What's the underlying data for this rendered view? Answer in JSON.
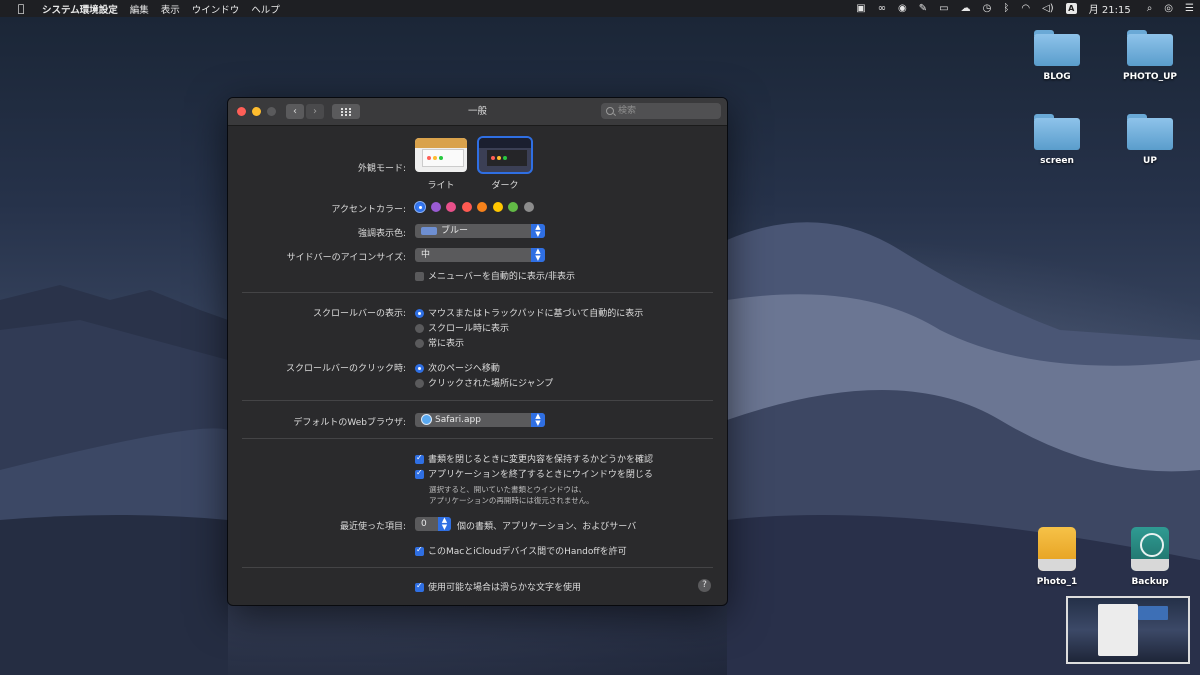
{
  "menubar": {
    "app_name": "システム環境設定",
    "items": [
      "編集",
      "表示",
      "ウインドウ",
      "ヘルプ"
    ],
    "clock": "月 21:15",
    "input_badge": "A",
    "status_icons": [
      "screen-mirroring-icon",
      "creative-cloud-icon",
      "toggl-icon",
      "pin-icon",
      "battery-icon",
      "cloud-icon",
      "time-machine-icon",
      "bluetooth-icon",
      "wifi-icon",
      "volume-icon",
      "input-source-icon",
      "spotlight-icon",
      "siri-icon",
      "notification-center-icon"
    ]
  },
  "desktop": {
    "icons": [
      {
        "label": "BLOG",
        "kind": "folder"
      },
      {
        "label": "PHOTO_UP",
        "kind": "folder"
      },
      {
        "label": "screen",
        "kind": "folder"
      },
      {
        "label": "UP",
        "kind": "folder"
      },
      {
        "label": "Photo_1",
        "kind": "drive-yellow"
      },
      {
        "label": "Backup",
        "kind": "time-machine-drive"
      }
    ]
  },
  "window": {
    "title": "一般",
    "search_placeholder": "検索",
    "appearance": {
      "label": "外観モード:",
      "options": [
        "ライト",
        "ダーク"
      ],
      "selected": "ダーク"
    },
    "accent": {
      "label": "アクセントカラー:",
      "colors": [
        "#3478f6",
        "#9a5bd3",
        "#e8508a",
        "#ff5a52",
        "#f7821b",
        "#ffc600",
        "#62ba46",
        "#8c8c8c"
      ],
      "selected_index": 0
    },
    "highlight": {
      "label": "強調表示色:",
      "value": "ブルー"
    },
    "sidebar_icon_size": {
      "label": "サイドバーのアイコンサイズ:",
      "value": "中"
    },
    "menubar_autohide": {
      "label": "メニューバーを自動的に表示/非表示",
      "checked": false
    },
    "scrollbar_show": {
      "label": "スクロールバーの表示:",
      "options": [
        "マウスまたはトラックパッドに基づいて自動的に表示",
        "スクロール時に表示",
        "常に表示"
      ],
      "selected_index": 0
    },
    "scrollbar_click": {
      "label": "スクロールバーのクリック時:",
      "options": [
        "次のページへ移動",
        "クリックされた場所にジャンプ"
      ],
      "selected_index": 0
    },
    "browser": {
      "label": "デフォルトのWebブラウザ:",
      "value": "Safari.app"
    },
    "ask_keep_changes": {
      "label": "書類を閉じるときに変更内容を保持するかどうかを確認",
      "checked": true
    },
    "close_windows": {
      "label": "アプリケーションを終了するときにウインドウを閉じる",
      "checked": true
    },
    "close_note_line1": "選択すると、開いていた書類とウインドウは、",
    "close_note_line2": "アプリケーションの再開時には復元されません。",
    "recent": {
      "label": "最近使った項目:",
      "value": "0",
      "suffix": "個の書類、アプリケーション、およびサーバ"
    },
    "handoff": {
      "label": "このMacとiCloudデバイス間でのHandoffを許可",
      "checked": true
    },
    "font_smoothing": {
      "label": "使用可能な場合は滑らかな文字を使用",
      "checked": true
    },
    "help_label": "?"
  }
}
